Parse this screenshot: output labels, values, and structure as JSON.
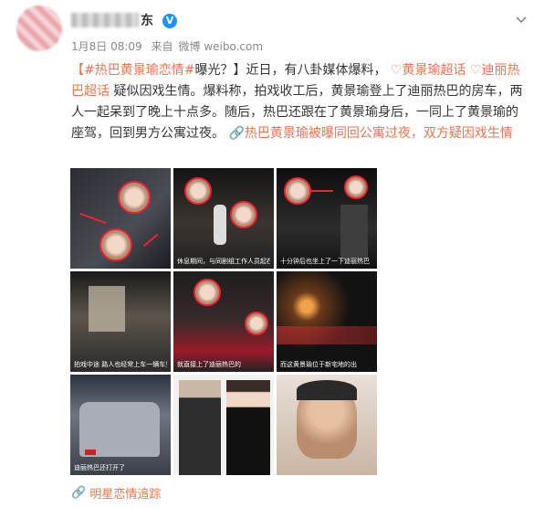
{
  "post": {
    "username_suffix": "东",
    "vip_badge": "V",
    "date": "1月8日 08:09",
    "source_prefix": "来自",
    "source": "微博 weibo.com",
    "text": {
      "tag1": "【#热巴黄景瑜恋情#",
      "after_tag1": "曝光？】近日，有八卦媒体爆料，",
      "topic1": "黄景瑜超话",
      "topic2": "迪丽热巴超话",
      "body": " 疑似因戏生情。爆料称，拍戏收工后，黄景瑜登上了迪丽热巴的房车，两人一起呆到了晚上十点多。随后，热巴还跟在了黄景瑜身后，一同上了黄景瑜的座驾，回到男方公寓过夜。",
      "link": "热巴黄景瑜被曝同回公寓过夜，双方疑因戏生情"
    },
    "images": [
      {
        "caption": ""
      },
      {
        "caption": "休息期间，与同剧组工作人员起在此"
      },
      {
        "caption": "十分钟后也坐上了一下迪丽热巴"
      },
      {
        "caption": "拍戏中途  路人也经常上车一辆车里停车"
      },
      {
        "caption": "就直接上了迪丽热巴的"
      },
      {
        "caption": "而这黄景瑜位于新宅地的出"
      },
      {
        "caption": "迪丽热巴还打开了"
      },
      {
        "caption": ""
      },
      {
        "caption": ""
      }
    ],
    "footer_link": "明星恋情追踪"
  },
  "colors": {
    "accent": "#eb7350",
    "badge": "#1e90ff",
    "annotation": "#e22233"
  }
}
